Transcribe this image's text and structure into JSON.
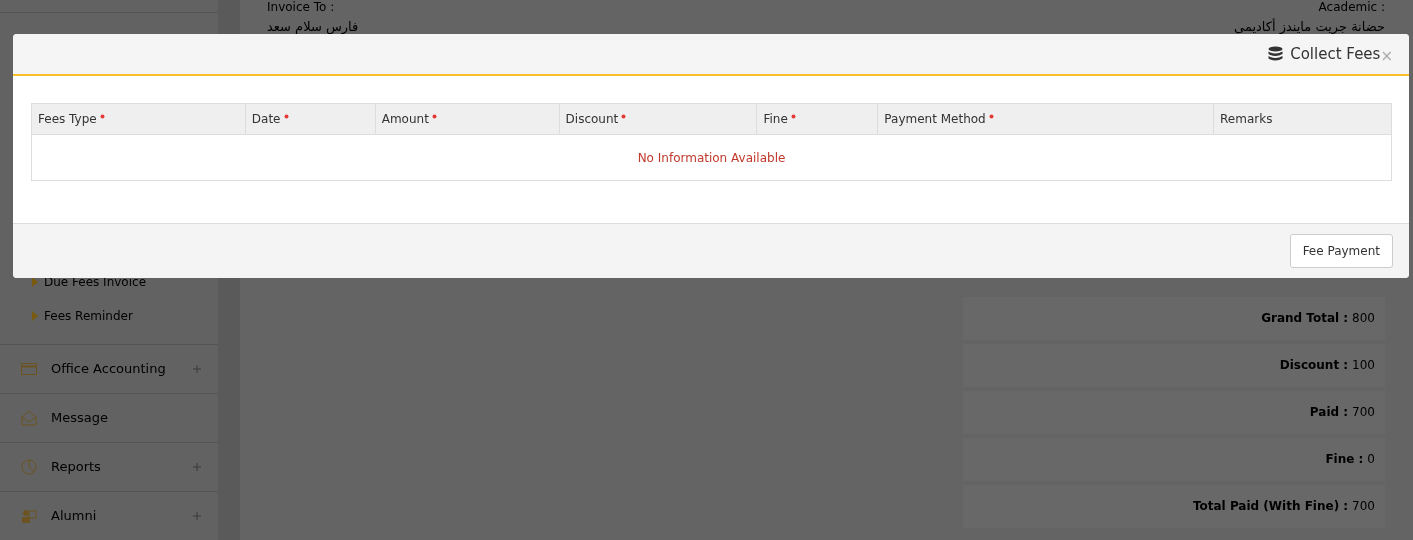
{
  "sidebar": {
    "sub_items": [
      {
        "label": "Due Fees Invoice"
      },
      {
        "label": "Fees Reminder"
      }
    ],
    "items": [
      {
        "label": "Office Accounting",
        "kind": "card",
        "expandable": true
      },
      {
        "label": "Message",
        "kind": "envelope",
        "expandable": false
      },
      {
        "label": "Reports",
        "kind": "pie",
        "expandable": true
      },
      {
        "label": "Alumni",
        "kind": "people",
        "expandable": true
      }
    ]
  },
  "invoice": {
    "invoice_to_label": "Invoice To :",
    "invoice_to_name": "فارس سلام سعد",
    "academic_label": "Academic :",
    "academic_name": "حضانة جريت مايندز أكاديمى"
  },
  "summary": [
    {
      "label": "Grand Total :",
      "value": "800"
    },
    {
      "label": "Discount :",
      "value": "100"
    },
    {
      "label": "Paid :",
      "value": "700"
    },
    {
      "label": "Fine :",
      "value": "0"
    },
    {
      "label": "Total Paid (With Fine) :",
      "value": "700"
    }
  ],
  "modal": {
    "title": "Collect Fees",
    "close": "×",
    "columns": [
      {
        "label": "Fees Type",
        "required": true
      },
      {
        "label": "Date",
        "required": true
      },
      {
        "label": "Amount",
        "required": true
      },
      {
        "label": "Discount",
        "required": true
      },
      {
        "label": "Fine",
        "required": true
      },
      {
        "label": "Payment Method",
        "required": true
      },
      {
        "label": "Remarks",
        "required": false
      }
    ],
    "empty_message": "No Information Available",
    "button": "Fee Payment"
  }
}
